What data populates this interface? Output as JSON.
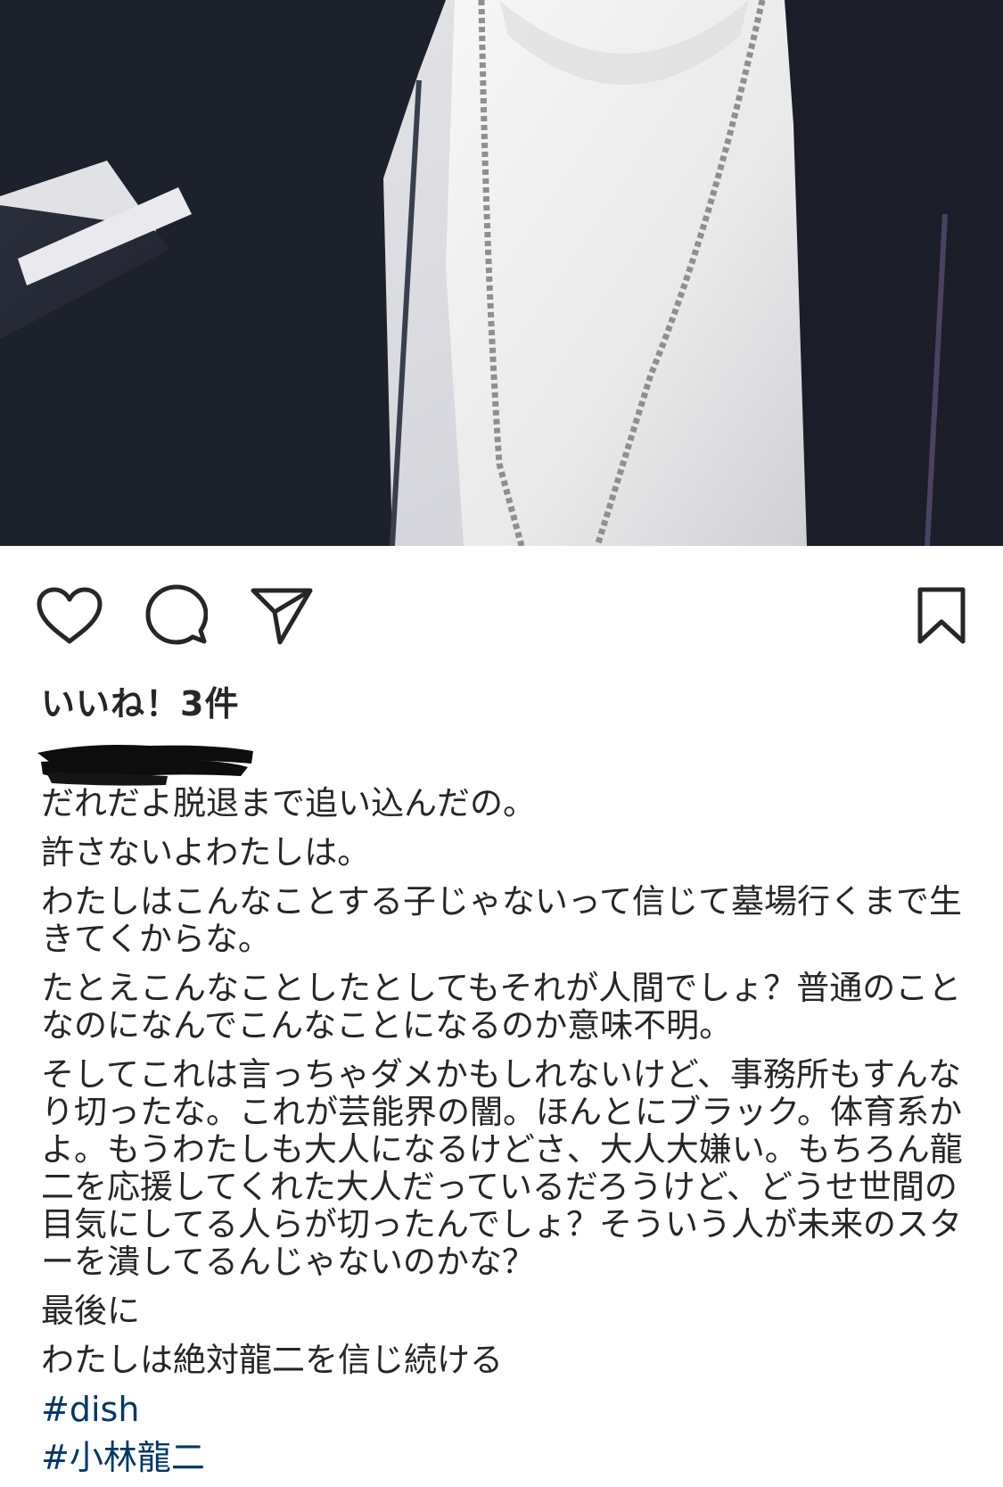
{
  "post": {
    "photo": {
      "alt_icon": "selfie-photo",
      "colors": {
        "jacket": "#1f2330",
        "shirt": "#ececec",
        "background": "#d9d9de",
        "chain": "#8a8a8a"
      }
    },
    "actions": {
      "like_icon": "heart-icon",
      "comment_icon": "comment-icon",
      "share_icon": "paper-plane-icon",
      "save_icon": "bookmark-icon"
    },
    "likes_text": "いいね！3件",
    "caption_lines": [
      "だれだよ脱退まで追い込んだの。",
      "許さないよわたしは。",
      "わたしはこんなことする子じゃないって信じて墓場行くまで生きてくからな。",
      "たとえこんなことしたとしてもそれが人間でしょ？普通のことなのになんでこんなことになるのか意味不明。",
      "そしてこれは言っちゃダメかもしれないけど、事務所もすんなり切ったな。これが芸能界の闇。ほんとにブラック。体育系かよ。もうわたしも大人になるけどさ、大人大嫌い。もちろん龍二を応援してくれた大人だっているだろうけど、どうせ世間の目気にしてる人らが切ったんでしょ？そういう人が未来のスターを潰してるんじゃないのかな？",
      "最後に",
      "わたしは絶対龍二を信じ続ける"
    ],
    "hashtags": [
      "#dish",
      "#小林龍二"
    ],
    "link_color": "#00376b"
  }
}
